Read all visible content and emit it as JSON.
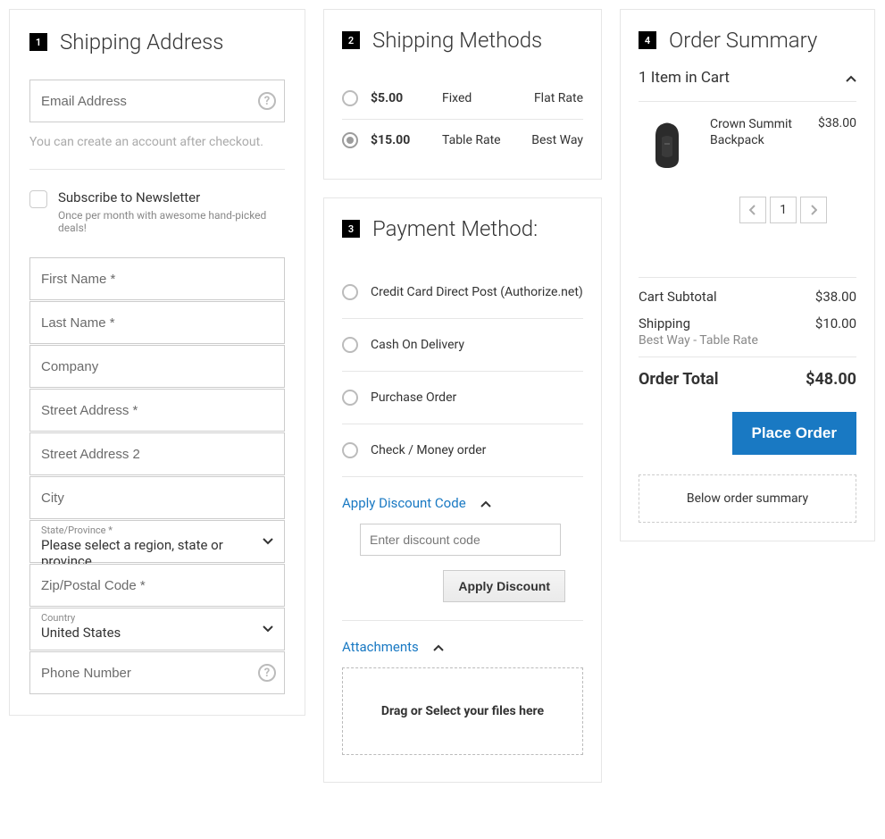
{
  "shipping_address": {
    "title": "Shipping Address",
    "email_placeholder": "Email Address",
    "help_text": "You can create an account after checkout.",
    "newsletter_label": "Subscribe to Newsletter",
    "newsletter_sub": "Once per month with awesome hand-picked deals!",
    "first_name": "First Name *",
    "last_name": "Last Name *",
    "company": "Company",
    "street1": "Street Address *",
    "street2": "Street Address 2",
    "city": "City",
    "region_label": "State/Province *",
    "region_value": "Please select a region, state or province",
    "zip": "Zip/Postal Code *",
    "country_label": "Country",
    "country_value": "United States",
    "phone": "Phone Number"
  },
  "shipping_methods": {
    "title": "Shipping Methods",
    "rows": [
      {
        "price": "$5.00",
        "method": "Fixed",
        "carrier": "Flat Rate",
        "selected": false
      },
      {
        "price": "$15.00",
        "method": "Table Rate",
        "carrier": "Best Way",
        "selected": true
      }
    ]
  },
  "payment": {
    "title": "Payment Method:",
    "methods": [
      "Credit Card Direct Post (Authorize.net)",
      "Cash On Delivery",
      "Purchase Order",
      "Check / Money order"
    ],
    "discount_toggle": "Apply Discount Code",
    "discount_placeholder": "Enter discount code",
    "apply_button": "Apply Discount",
    "attachments_toggle": "Attachments",
    "dropzone": "Drag or Select your files here"
  },
  "summary": {
    "title": "Order Summary",
    "cart_count_label": "1 Item in Cart",
    "item": {
      "name": "Crown Summit Backpack",
      "price": "$38.00",
      "qty": "1"
    },
    "subtotal_label": "Cart Subtotal",
    "subtotal_value": "$38.00",
    "shipping_label": "Shipping",
    "shipping_value": "$10.00",
    "shipping_sub": "Best Way - Table Rate",
    "grand_label": "Order Total",
    "grand_value": "$48.00",
    "place_order": "Place Order",
    "below": "Below order summary"
  }
}
